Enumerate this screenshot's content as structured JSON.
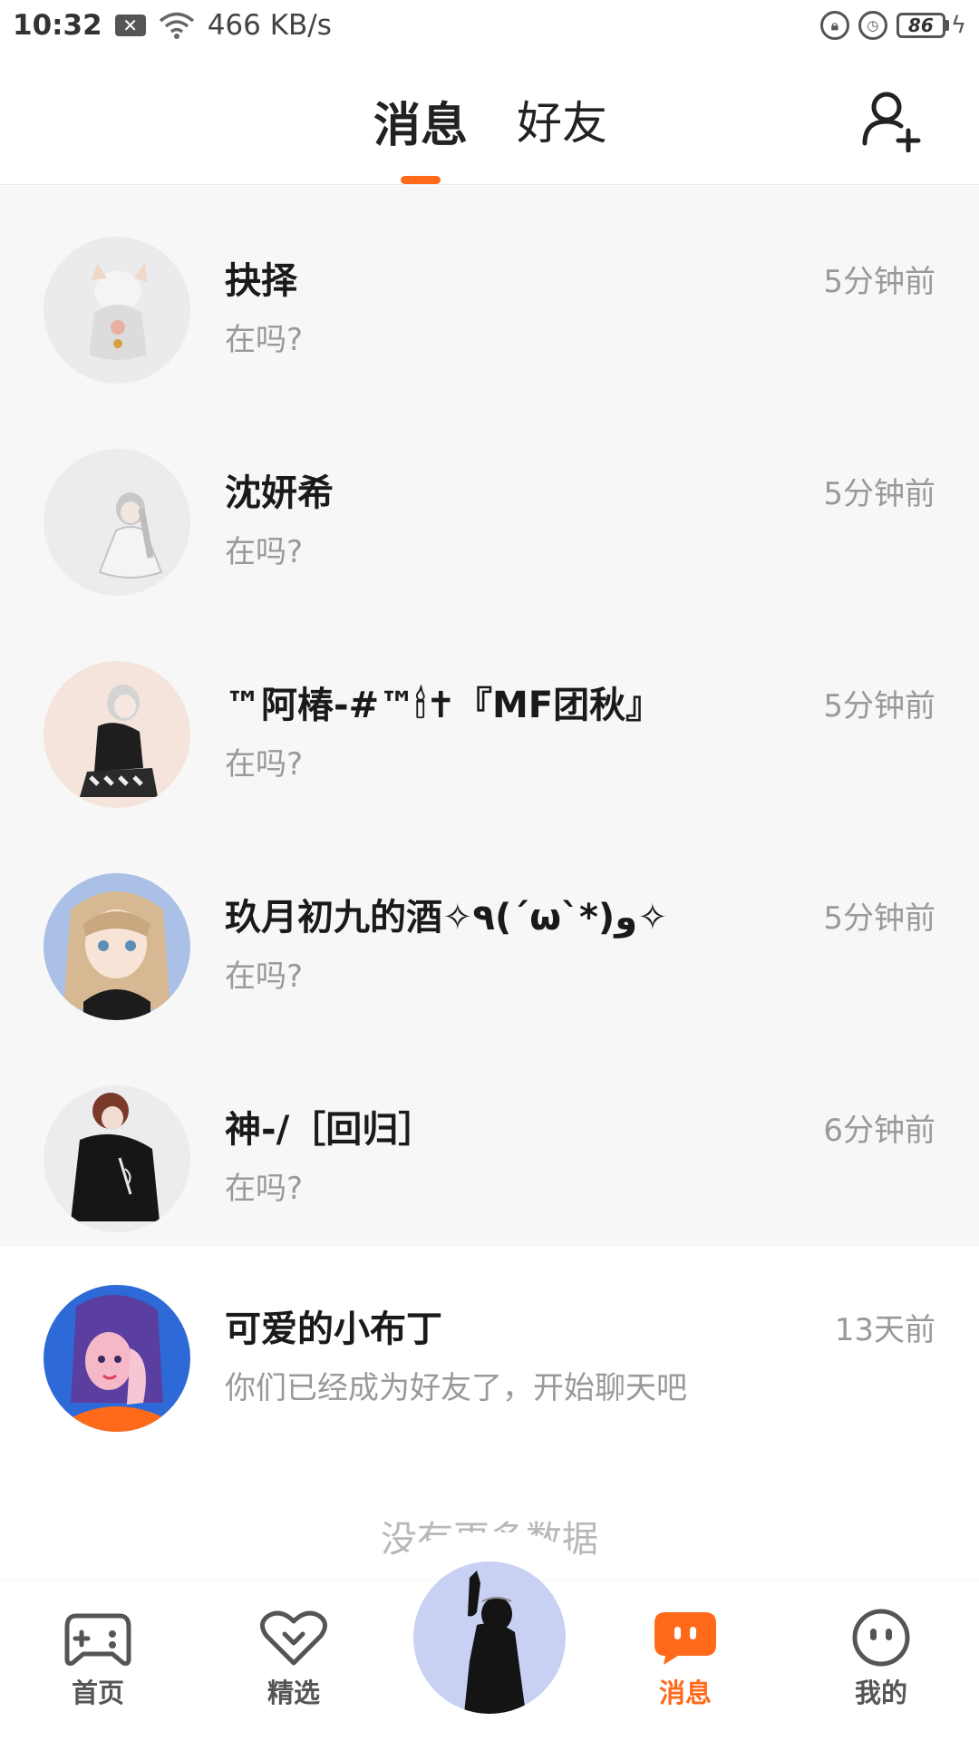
{
  "status_bar": {
    "time": "10:32",
    "notification_glyph": "✕",
    "network_speed": "466 KB/s",
    "battery_level": "86"
  },
  "header": {
    "tabs": [
      {
        "label": "消息",
        "active": true
      },
      {
        "label": "好友",
        "active": false
      }
    ],
    "accent_color": "#ff6a1a",
    "add_friend_icon": "person-add-icon"
  },
  "conversations": [
    {
      "name": "抉择",
      "preview": "在吗?",
      "time": "5分钟前",
      "unread": true
    },
    {
      "name": "沈妍希",
      "preview": "在吗?",
      "time": "5分钟前",
      "unread": true
    },
    {
      "name": "™阿椿-#™🕯✝『MF团秋』",
      "preview": "在吗?",
      "time": "5分钟前",
      "unread": true
    },
    {
      "name": "玖月初九的酒✧٩(ˊωˋ*)و✧",
      "preview": "在吗?",
      "time": "5分钟前",
      "unread": true
    },
    {
      "name": "神-/［回归］",
      "preview": "在吗?",
      "time": "6分钟前",
      "unread": true
    },
    {
      "name": "可爱的小布丁",
      "preview": "你们已经成为好友了，开始聊天吧",
      "time": "13天前",
      "unread": false
    }
  ],
  "list_footer": "没有更多数据",
  "bottom_nav": {
    "items": [
      {
        "label": "首页",
        "icon": "gamepad-icon",
        "active": false
      },
      {
        "label": "精选",
        "icon": "heart-icon",
        "active": false
      },
      {
        "label": "消息",
        "icon": "chat-bubble-icon",
        "active": true
      },
      {
        "label": "我的",
        "icon": "smiley-icon",
        "active": false
      }
    ],
    "active_color": "#ff6a1a",
    "inactive_color": "#555555"
  }
}
